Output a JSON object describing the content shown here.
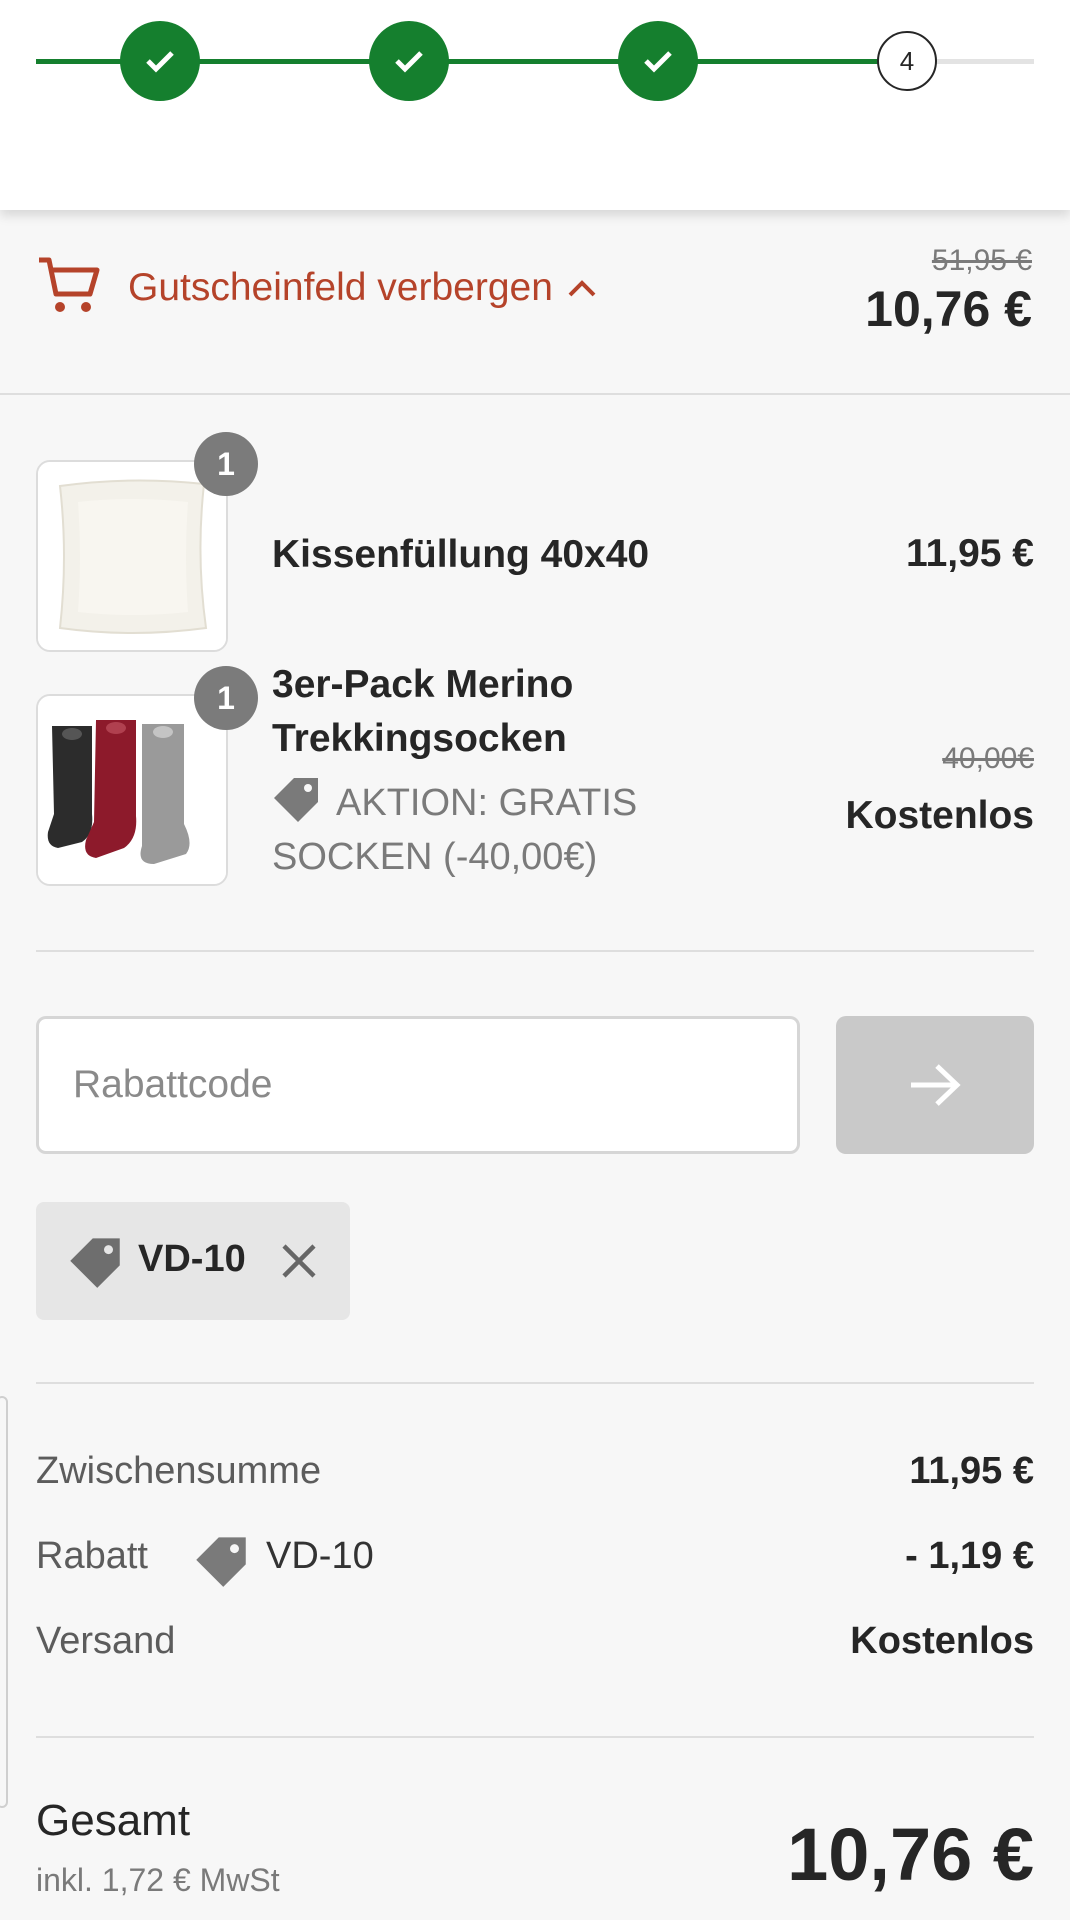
{
  "stepper": {
    "current_step_label": "4",
    "colors": {
      "done": "#157f2e",
      "todo": "#e3e3e3"
    }
  },
  "summary_toggle": {
    "label": "Gutscheinfeld verbergen",
    "price_original": "51,95 €",
    "price_total": "10,76 €",
    "accent": "#b5432a"
  },
  "products": [
    {
      "quantity": "1",
      "title": "Kissenfüllung 40x40",
      "price": "11,95 €"
    },
    {
      "quantity": "1",
      "title_line1": "3er-Pack Merino",
      "title_line2": "Trekkingsocken",
      "promo_line1": "AKTION: GRATIS",
      "promo_line2": "SOCKEN (-40,00€)",
      "price_original": "40,00€",
      "price": "Kostenlos"
    }
  ],
  "coupon": {
    "placeholder": "Rabattcode",
    "value": "",
    "applied_code": "VD-10"
  },
  "totals": {
    "subtotal_label": "Zwischensumme",
    "subtotal_value": "11,95 €",
    "discount_label": "Rabatt",
    "discount_code": "VD-10",
    "discount_value": "- 1,19 €",
    "shipping_label": "Versand",
    "shipping_value": "Kostenlos",
    "total_label": "Gesamt",
    "tax_note": "inkl. 1,72 € MwSt",
    "total_value": "10,76 €"
  }
}
